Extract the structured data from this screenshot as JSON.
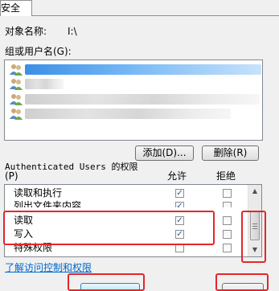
{
  "tab": {
    "label": "安全"
  },
  "object": {
    "label": "对象名称:",
    "value": "I:\\"
  },
  "groups": {
    "label": "组或用户名(G):",
    "users": [
      {
        "selected": true
      },
      {
        "selected": false
      },
      {
        "selected": false
      },
      {
        "selected": false
      }
    ]
  },
  "buttons": {
    "add": "添加(D)...",
    "remove": "删除(R)"
  },
  "permissions": {
    "title": "Authenticated Users 的权限",
    "hotkey": "(P)",
    "allow_header": "允许",
    "deny_header": "拒绝",
    "rows": [
      {
        "name": "读取和执行",
        "allow": true,
        "deny": false
      },
      {
        "name": "列出文件夹内容",
        "allow": true,
        "deny": false
      },
      {
        "name": "读取",
        "allow": true,
        "deny": false
      },
      {
        "name": "写入",
        "allow": true,
        "deny": false
      },
      {
        "name": "特殊权限",
        "allow": false,
        "deny": false
      }
    ]
  },
  "link": "了解访问控制和权限",
  "icons": {
    "check": "✓",
    "scroll_up": "▲",
    "scroll_down": "▼"
  },
  "colors": {
    "highlight_border": "#e4262a",
    "selection": "#3b8fe6",
    "link": "#0066cc"
  }
}
